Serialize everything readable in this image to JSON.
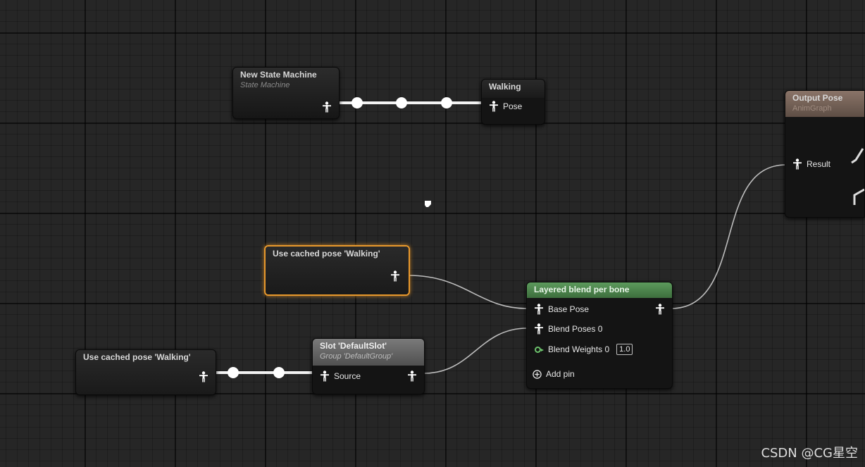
{
  "nodes": {
    "state_machine": {
      "title": "New State Machine",
      "subtitle": "State Machine"
    },
    "walking": {
      "title": "Walking",
      "pose_label": "Pose"
    },
    "output_pose": {
      "title": "Output Pose",
      "subtitle": "AnimGraph",
      "result_label": "Result"
    },
    "cached_pose_selected": {
      "title": "Use cached pose 'Walking'"
    },
    "cached_pose_lower": {
      "title": "Use cached pose 'Walking'"
    },
    "slot": {
      "title": "Slot 'DefaultSlot'",
      "subtitle": "Group 'DefaultGroup'",
      "source_label": "Source"
    },
    "layered_blend": {
      "title": "Layered blend per bone",
      "base_pose_label": "Base Pose",
      "blend_poses_label": "Blend Poses 0",
      "blend_weights_label": "Blend Weights 0",
      "blend_weights_value": "1.0",
      "add_pin_label": "Add pin"
    }
  },
  "watermark": "CSDN @CG星空",
  "colors": {
    "background": "#262626",
    "node_body": "#141414",
    "selection_orange": "#e8982c",
    "blend_header_green": "#4f8f4f",
    "output_header_brown": "#8a7468",
    "exec_pin_green": "#6dc46d"
  }
}
